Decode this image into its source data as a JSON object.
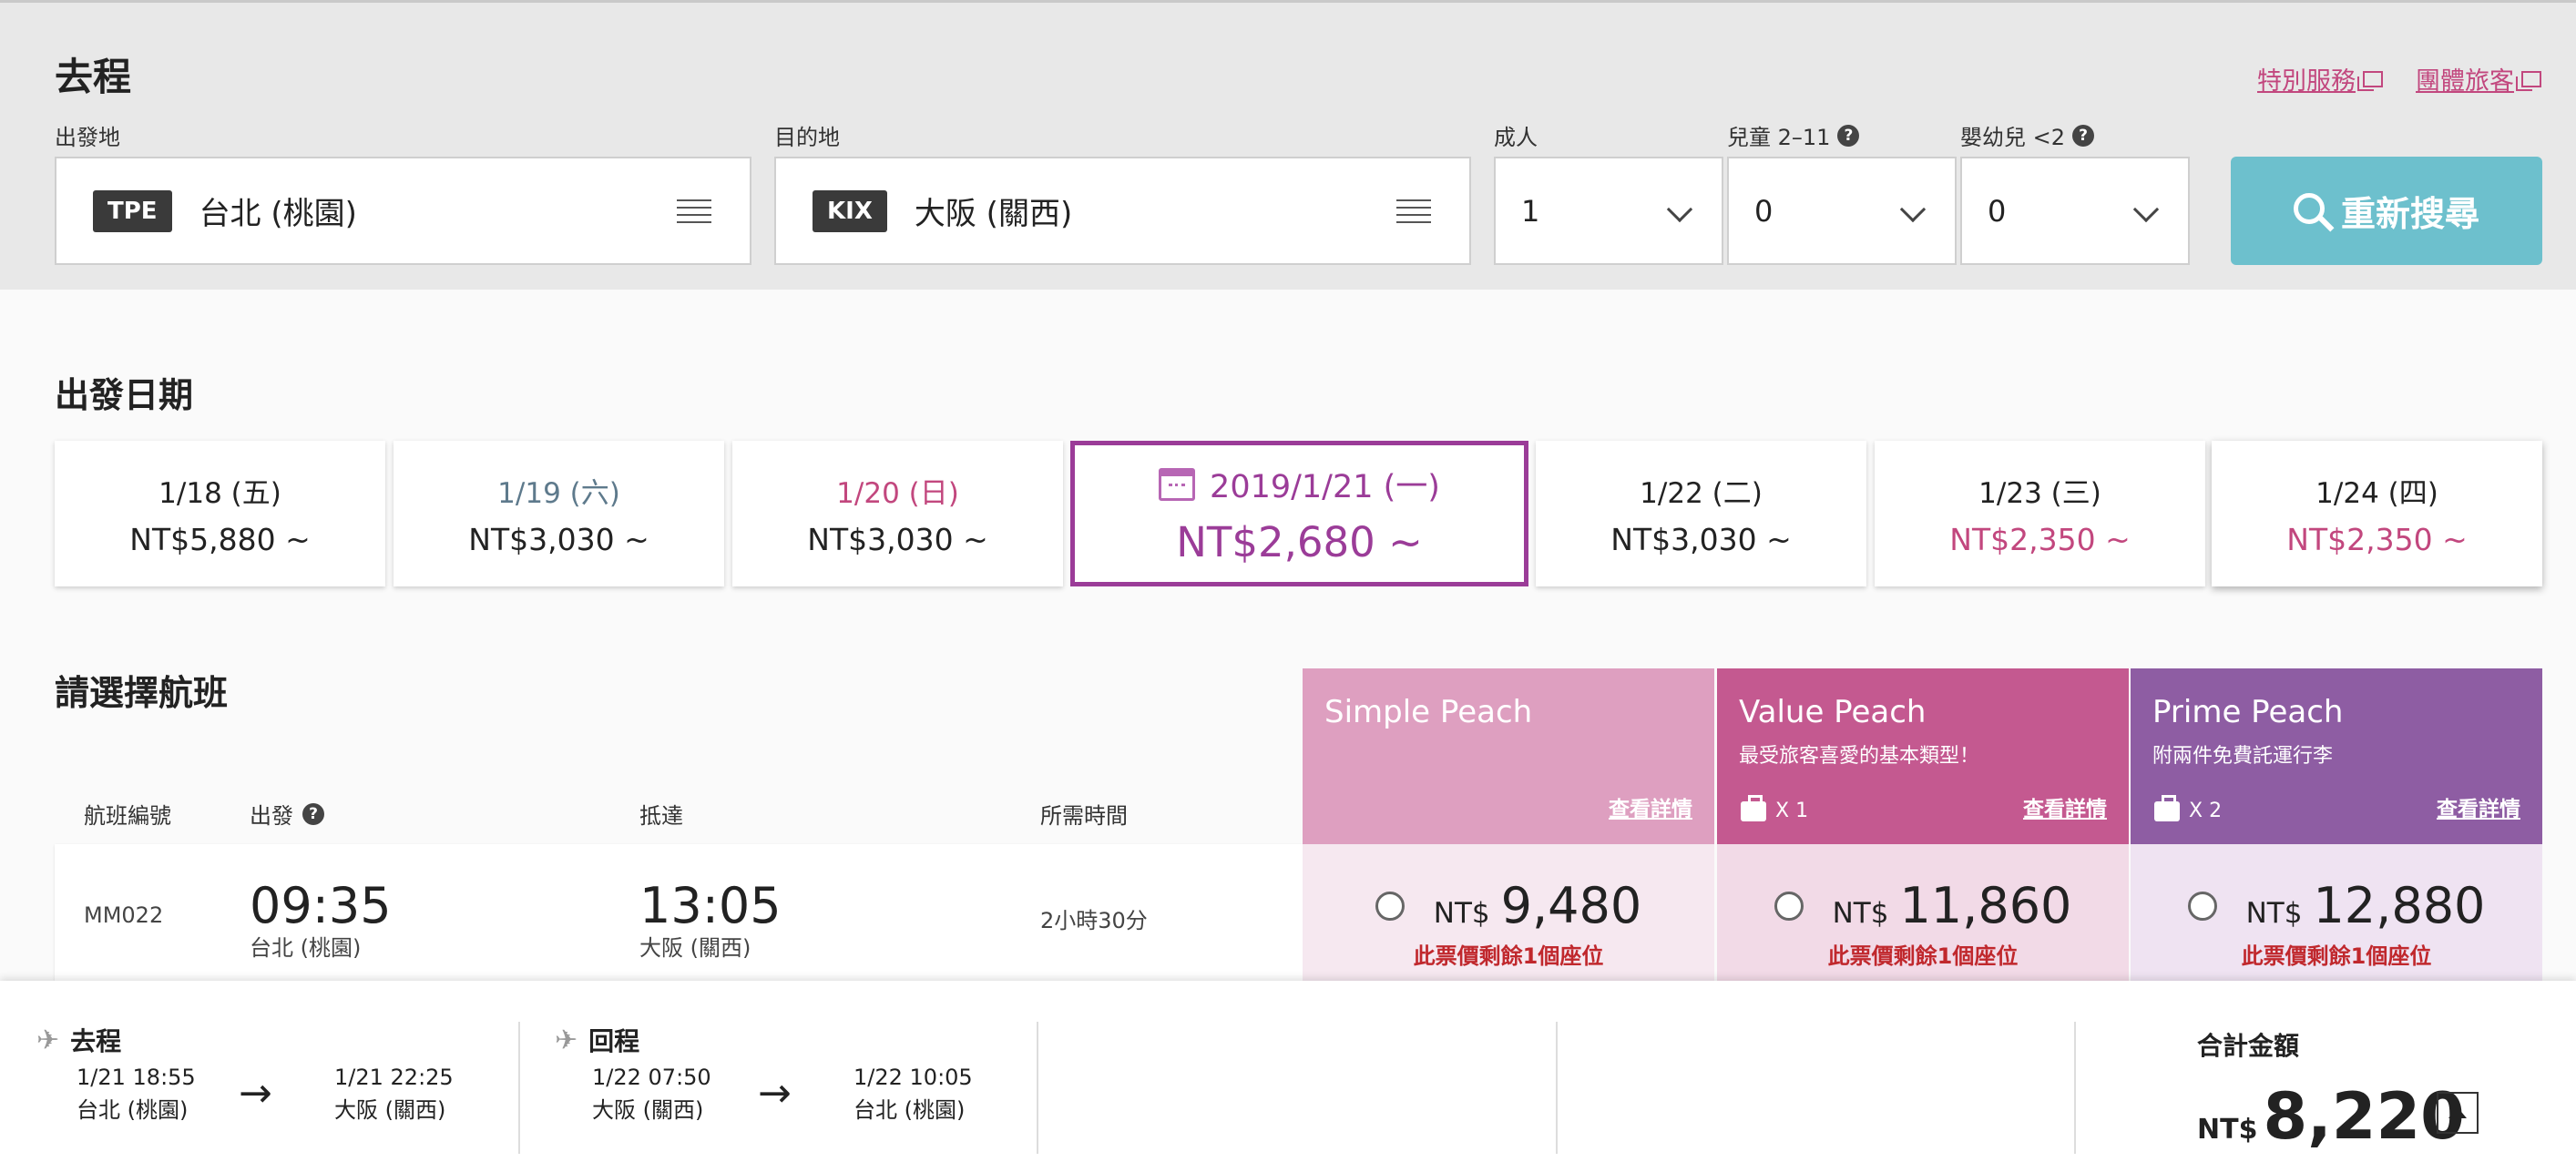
{
  "header": {
    "title": "去程",
    "links": [
      "特別服務",
      "團體旅客"
    ]
  },
  "search": {
    "origin_label": "出發地",
    "origin_code": "TPE",
    "origin_city": "台北 (桃園)",
    "dest_label": "目的地",
    "dest_code": "KIX",
    "dest_city": "大阪 (關西)",
    "adult_label": "成人",
    "adult_value": "1",
    "child_label": "兒童 2–11",
    "child_value": "0",
    "infant_label": "嬰幼兒 <2",
    "infant_value": "0",
    "search_button": "重新搜尋"
  },
  "dates": {
    "title": "出發日期",
    "items": [
      {
        "label": "1/18 (五)",
        "price": "NT$5,880 ~"
      },
      {
        "label": "1/19 (六)",
        "price": "NT$3,030 ~"
      },
      {
        "label": "1/20 (日)",
        "price": "NT$3,030 ~"
      },
      {
        "label": "2019/1/21 (一)",
        "price": "NT$2,680 ~"
      },
      {
        "label": "1/22 (二)",
        "price": "NT$3,030 ~"
      },
      {
        "label": "1/23 (三)",
        "price": "NT$2,350 ~"
      },
      {
        "label": "1/24 (四)",
        "price": "NT$2,350 ~"
      }
    ]
  },
  "flights": {
    "title": "請選擇航班",
    "columns": {
      "flight_no": "航班編號",
      "depart": "出發",
      "arrive": "抵達",
      "duration": "所需時間"
    },
    "fares": [
      {
        "name": "Simple Peach",
        "desc": "",
        "bag": "",
        "detail": "查看詳情",
        "color": "#de9fc0"
      },
      {
        "name": "Value Peach",
        "desc": "最受旅客喜愛的基本類型！",
        "bag": "X 1",
        "detail": "查看詳情",
        "color": "#c45990"
      },
      {
        "name": "Prime Peach",
        "desc": "附兩件免費託運行李",
        "bag": "X 2",
        "detail": "查看詳情",
        "color": "#8e5da3"
      }
    ],
    "rows": [
      {
        "flight_no": "MM022",
        "depart_time": "09:35",
        "depart_city": "台北 (桃園)",
        "arrive_time": "13:05",
        "arrive_city": "大阪 (關西)",
        "duration": "2小時30分",
        "prices": [
          {
            "currency": "NT$",
            "amount": "9,480",
            "seats": "此票價剩餘1個座位"
          },
          {
            "currency": "NT$",
            "amount": "11,860",
            "seats": "此票價剩餘1個座位"
          },
          {
            "currency": "NT$",
            "amount": "12,880",
            "seats": "此票價剩餘1個座位"
          }
        ]
      }
    ]
  },
  "summary": {
    "outbound": {
      "title": "去程",
      "dep_time": "1/21 18:55",
      "dep_city": "台北 (桃園)",
      "arr_time": "1/21 22:25",
      "arr_city": "大阪 (關西)"
    },
    "inbound": {
      "title": "回程",
      "dep_time": "1/22 07:50",
      "dep_city": "大阪 (關西)",
      "arr_time": "1/22 10:05",
      "arr_city": "台北 (桃園)"
    },
    "arrow": "→",
    "total_label": "合計金額",
    "total_currency": "NT$",
    "total_amount": "8,220"
  }
}
